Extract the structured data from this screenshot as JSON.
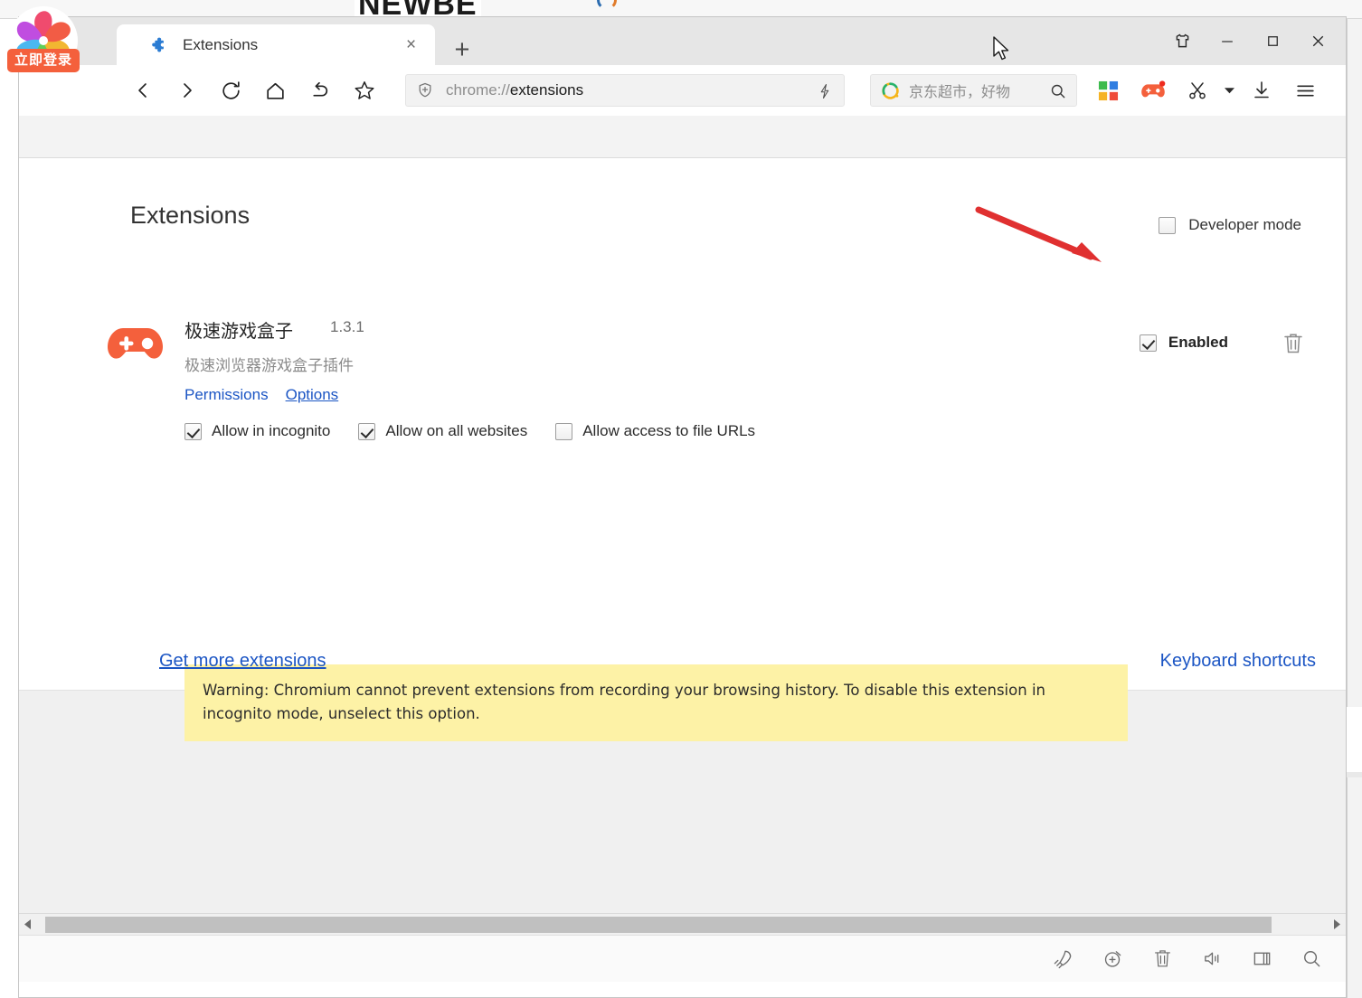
{
  "background": {
    "partial_text": "NEWBE"
  },
  "window": {
    "controls": [
      {
        "name": "theme-shirt-button",
        "label": "Theme"
      },
      {
        "name": "minimize-button",
        "label": "Minimize"
      },
      {
        "name": "maximize-button",
        "label": "Maximize"
      },
      {
        "name": "close-button",
        "label": "Close"
      }
    ]
  },
  "tabs": {
    "items": [
      {
        "title": "Extensions",
        "favicon": "puzzle-piece-icon",
        "active": true
      }
    ],
    "close_label": "×",
    "new_tab_label": "+"
  },
  "account": {
    "badge_label": "立即登录"
  },
  "toolbar": {
    "back_label": "Back",
    "forward_label": "Forward",
    "reload_label": "Reload",
    "home_label": "Home",
    "undo_label": "Undo",
    "bookmark_label": "Bookmark",
    "extension_icons": [
      {
        "name": "microsoft-squares-icon",
        "label": "Apps"
      },
      {
        "name": "gamepad-extension-icon",
        "label": "极速游戏盒子"
      },
      {
        "name": "scissors-screenshot-icon",
        "label": "Screenshot"
      },
      {
        "name": "download-icon",
        "label": "Downloads"
      },
      {
        "name": "hamburger-menu-icon",
        "label": "Menu"
      }
    ],
    "caret_label": "▾"
  },
  "omnibox": {
    "scheme": "chrome://",
    "path": "extensions",
    "full_url": "chrome://extensions",
    "shield_icon": "shield-plus-icon",
    "bolt_icon": "lightning-bolt-icon"
  },
  "search": {
    "placeholder": "京东超市，好物",
    "engine_icon": "360-search-logo-icon",
    "submit_icon": "magnifier-icon"
  },
  "page": {
    "title": "Extensions",
    "developer_mode": {
      "label": "Developer mode",
      "checked": false
    },
    "extension": {
      "name": "极速游戏盒子",
      "version": "1.3.1",
      "description": "极速浏览器游戏盒子插件",
      "icon": "orange-gamepad-icon",
      "links": [
        {
          "label": "Permissions",
          "underlined": false
        },
        {
          "label": "Options",
          "underlined": true
        }
      ],
      "checkboxes": [
        {
          "label": "Allow in incognito",
          "checked": true
        },
        {
          "label": "Allow on all websites",
          "checked": true
        },
        {
          "label": "Allow access to file URLs",
          "checked": false
        }
      ],
      "enabled": {
        "label": "Enabled",
        "checked": true
      },
      "remove_label": "Remove",
      "warning": "Warning: Chromium cannot prevent extensions from recording your browsing history. To disable this extension in incognito mode, unselect this option."
    },
    "footer": {
      "get_more_label": "Get more extensions",
      "keyboard_shortcuts_label": "Keyboard shortcuts"
    }
  },
  "statusbar": {
    "icons": [
      {
        "name": "rocket-icon",
        "label": "Boost"
      },
      {
        "name": "stopwatch-add-icon",
        "label": "Timer"
      },
      {
        "name": "trash-icon",
        "label": "Clear"
      },
      {
        "name": "speaker-icon",
        "label": "Sound"
      },
      {
        "name": "window-split-icon",
        "label": "Split window"
      },
      {
        "name": "search-icon",
        "label": "Find"
      }
    ]
  },
  "scrollbar": {
    "left_arrow": "◀",
    "right_arrow": "▶"
  },
  "annotation": {
    "arrow_color": "#e03030",
    "points_to": "developer-mode-checkbox"
  },
  "colors": {
    "tab_strip": "#e6e6e6",
    "warning_bg": "#fdf2a6",
    "link": "#1b55c4",
    "accent_orange": "#f4603c"
  }
}
